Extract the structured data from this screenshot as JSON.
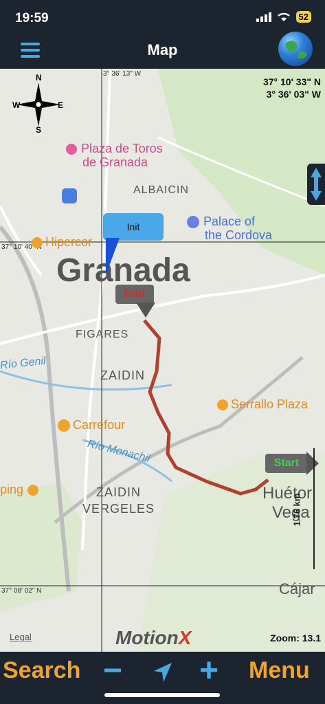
{
  "status_bar": {
    "time": "19:59",
    "battery": "52",
    "icons": [
      "location-arrow-icon",
      "signal-icon",
      "wifi-icon",
      "battery-icon"
    ]
  },
  "header": {
    "title": "Map",
    "left_icon": "menu-icon",
    "right_icon": "globe-icon"
  },
  "map": {
    "coordinates": {
      "lat": "37° 10' 33\" N",
      "lon": "3° 36' 03\" W"
    },
    "grid_labels": {
      "lon_top": "3° 36' 13\" W",
      "lat_mid": "37° 10' 40\" N",
      "lat_bottom": "37° 08' 02\" N"
    },
    "places": {
      "plaza_toros_1": "Plaza de Toros",
      "plaza_toros_2": "de Granada",
      "albaicin": "ALBAICIN",
      "palace_1": "Palace of",
      "palace_2": "the Cordova",
      "hipercor": "Hipercor",
      "granada": "Granada",
      "figares": "FIGARES",
      "rio_genil": "Río Genil",
      "zaidin": "ZAIDIN",
      "serrallo": "Serrallo Plaza",
      "carrefour": "Carrefour",
      "rio_monachil": "Río Monachil",
      "ping": "ping",
      "zaidin_vergeles_1": "ZAIDIN",
      "zaidin_vergeles_2": "VERGELES",
      "huetor_1": "Huétor",
      "huetor_2": "Vega",
      "cajar": "Cájar"
    },
    "markers": {
      "init": "Init",
      "end": "End",
      "start": "Start"
    },
    "scale": "1.76 km",
    "compass": {
      "n": "N",
      "s": "S",
      "e": "E",
      "w": "W"
    },
    "zoom": "Zoom: 13.1",
    "legal": "Legal",
    "brand_1": "Motion",
    "brand_2": "X",
    "route_color": "#b0412e"
  },
  "toolbar": {
    "search": "Search",
    "minus": "−",
    "plus": "+",
    "menu": "Menu",
    "accent": "#f0a32a",
    "icon_color": "#4aa8e0"
  }
}
